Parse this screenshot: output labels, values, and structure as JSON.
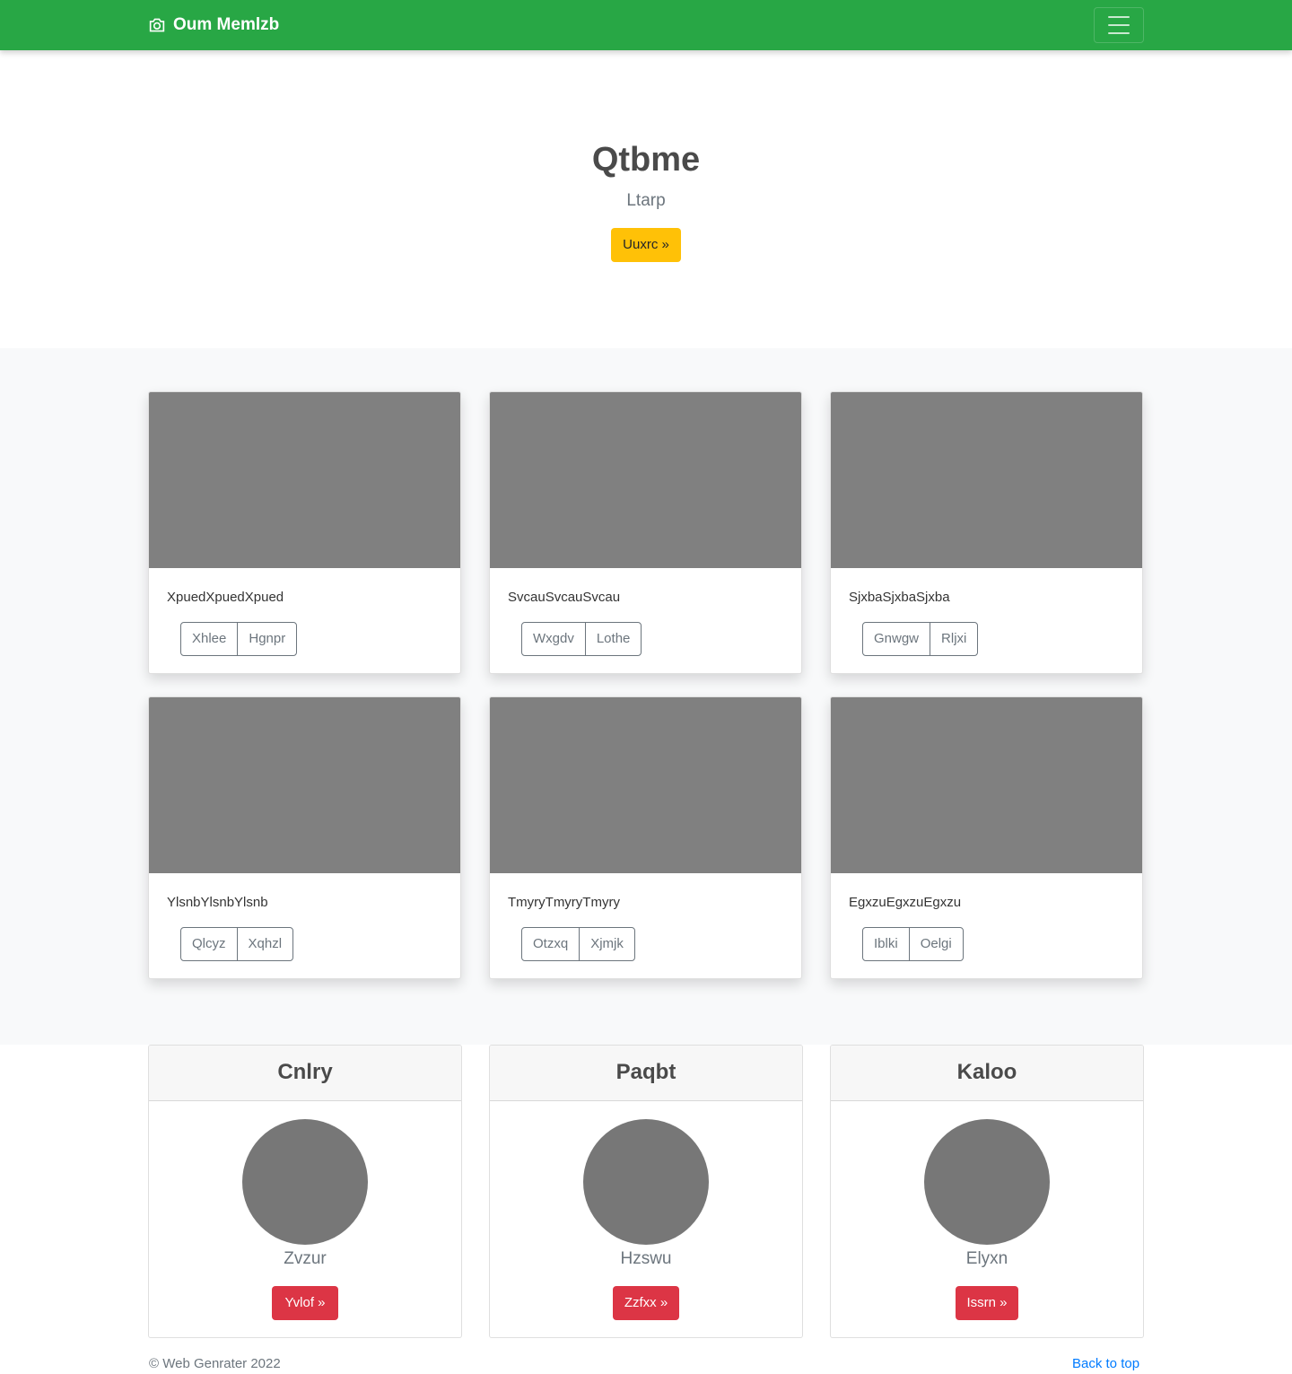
{
  "navbar": {
    "brand": "Oum Memlzb",
    "brand_icon": "camera-icon",
    "toggler_icon": "hamburger-icon"
  },
  "hero": {
    "title": "Qtbme",
    "subtitle": "Ltarp",
    "button": "Uuxrc »",
    "button_color": "#ffc107"
  },
  "album": {
    "cards": [
      {
        "text": "XpuedXpuedXpued",
        "btn1": "Xhlee",
        "btn2": "Hgnpr"
      },
      {
        "text": "SvcauSvcauSvcau",
        "btn1": "Wxgdv",
        "btn2": "Lothe"
      },
      {
        "text": "SjxbaSjxbaSjxba",
        "btn1": "Gnwgw",
        "btn2": "Rljxi"
      },
      {
        "text": "YlsnbYlsnbYlsnb",
        "btn1": "Qlcyz",
        "btn2": "Xqhzl"
      },
      {
        "text": "TmyryTmyryTmyry",
        "btn1": "Otzxq",
        "btn2": "Xjmjk"
      },
      {
        "text": "EgxzuEgxzuEgxzu",
        "btn1": "Iblki",
        "btn2": "Oelgi"
      }
    ]
  },
  "pricing": [
    {
      "header": "Cnlry",
      "name": "Zvzur",
      "button": "Yvlof »"
    },
    {
      "header": "Paqbt",
      "name": "Hzswu",
      "button": "Zzfxx »"
    },
    {
      "header": "Kaloo",
      "name": "Elyxn",
      "button": "Issrn »"
    }
  ],
  "footer": {
    "copyright": "© Web Genrater 2022",
    "back_to_top": "Back to top"
  },
  "colors": {
    "navbar": "#28a745",
    "accent_button": "#ffc107",
    "danger_button": "#dc3545",
    "link": "#007bff"
  }
}
